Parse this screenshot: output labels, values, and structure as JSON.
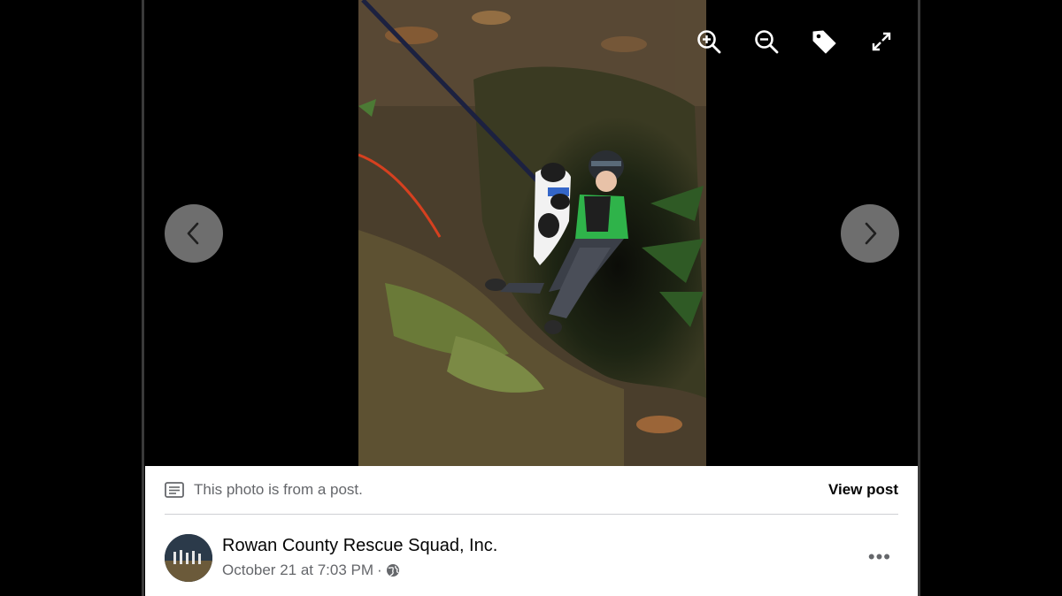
{
  "viewer": {
    "photo_alt": "Rescuer rappelling out of a sinkhole holding a dog",
    "toolbar": [
      {
        "name": "zoom-in-icon"
      },
      {
        "name": "zoom-out-icon"
      },
      {
        "name": "tag-icon"
      },
      {
        "name": "fullscreen-icon"
      }
    ],
    "prev_icon": "chevron-left-icon",
    "next_icon": "chevron-right-icon"
  },
  "post": {
    "note": "This photo is from a post.",
    "view_post_label": "View post",
    "author": "Rowan County Rescue Squad, Inc.",
    "timestamp": "October 21 at 7:03 PM",
    "separator": "·",
    "audience_icon": "globe-icon",
    "more_label": "•••"
  },
  "colors": {
    "panel_bg": "#ffffff",
    "secondary_text": "#65676b",
    "primary_text": "#050505",
    "nav_button": "#c8c8c8"
  }
}
